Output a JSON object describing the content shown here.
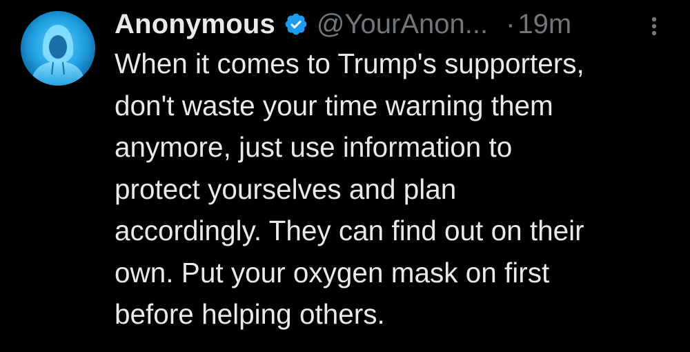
{
  "tweet": {
    "author": {
      "display_name": "Anonymous",
      "handle": "@YourAnon...",
      "verified": true,
      "avatar_icon": "hooded-figure-avatar-icon"
    },
    "separator": "·",
    "timestamp": "19m",
    "more_icon": "more-options-icon",
    "text": "When it comes to Trump's supporters,\ndon't waste your time warning them\nanymore, just use information to\nprotect yourselves and plan\naccordingly. They can find out on their\nown. Put your oxygen mask on first\nbefore helping others."
  },
  "colors": {
    "background": "#000000",
    "primary_text": "#e7e9ea",
    "secondary_text": "#71767b",
    "verified_badge": "#1d9bf0",
    "avatar_glow": "#36b6f0"
  }
}
